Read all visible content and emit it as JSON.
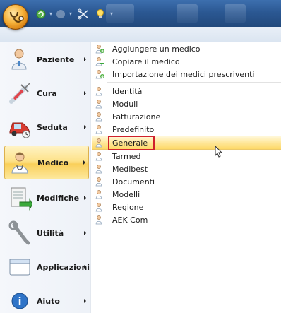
{
  "left_menu": {
    "items": [
      {
        "label": "Paziente",
        "icon": "patient-icon"
      },
      {
        "label": "Cura",
        "icon": "syringe-icon"
      },
      {
        "label": "Seduta",
        "icon": "car-icon"
      },
      {
        "label": "Medico",
        "icon": "doctor-icon",
        "active": true
      },
      {
        "label": "Modifiche",
        "icon": "edit-document-icon"
      },
      {
        "label": "Utilità",
        "icon": "wrench-icon"
      },
      {
        "label": "Applicazioni",
        "icon": "window-icon"
      },
      {
        "label": "Aiuto",
        "icon": "help-icon"
      }
    ]
  },
  "submenu": {
    "group1": [
      {
        "label": "Aggiungere un medico",
        "icon": "doctor-add-icon"
      },
      {
        "label": "Copiare il medico",
        "icon": "doctor-copy-icon"
      },
      {
        "label": "Importazione dei medici prescriventi",
        "icon": "doctor-import-icon"
      }
    ],
    "group2": [
      {
        "label": "Identità"
      },
      {
        "label": "Moduli"
      },
      {
        "label": "Fatturazione"
      },
      {
        "label": "Predefinito"
      },
      {
        "label": "Generale",
        "highlighted": true
      },
      {
        "label": "Tarmed"
      },
      {
        "label": "Medibest"
      },
      {
        "label": "Documenti"
      },
      {
        "label": "Modelli"
      },
      {
        "label": "Regione"
      },
      {
        "label": "AEK Com"
      }
    ]
  },
  "colors": {
    "titlebar": "#2b5893",
    "active_item": "#fde28a",
    "highlight_box": "#d0202c"
  }
}
